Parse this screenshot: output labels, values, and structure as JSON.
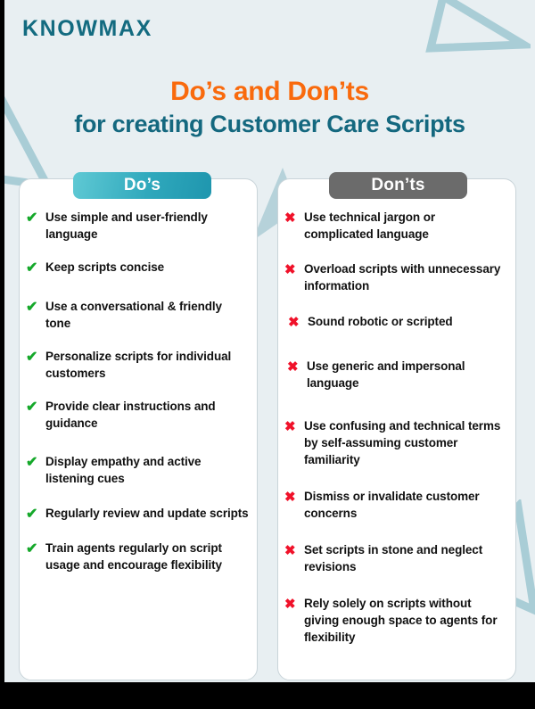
{
  "brand": {
    "logo_text": "KNOWMAX",
    "logo_color": "#136b80"
  },
  "title": {
    "line1": "Do’s and Don’ts",
    "line1_color": "#f96a0d",
    "line2": "for creating Customer Care Scripts",
    "line2_color": "#14687f"
  },
  "columns": {
    "dos": {
      "header": "Do’s",
      "header_bg": "#2fa8bc",
      "mark_icon": "check-icon",
      "mark_glyph": "✔",
      "mark_color": "#15a82a",
      "items": [
        "Use simple and user-friendly language",
        "Keep scripts concise",
        "Use a conversational & friendly tone",
        "Personalize scripts for individual customers",
        "Provide clear instructions and guidance",
        "Display empathy and active listening cues",
        "Regularly review and update scripts",
        "Train agents regularly on script usage and encourage flexibility"
      ]
    },
    "donts": {
      "header": "Don’ts",
      "header_bg": "#6b6b6b",
      "mark_icon": "cross-icon",
      "mark_glyph": "✖",
      "mark_color": "#f0122a",
      "items": [
        "Use technical jargon or complicated language",
        "Overload scripts with unnecessary information",
        "Sound robotic or scripted",
        "Use generic and impersonal language",
        "Use confusing and technical terms by self-assuming customer familiarity",
        "Dismiss or invalidate customer concerns",
        "Set scripts in stone and neglect revisions",
        "Rely solely on scripts without giving  enough space to agents for flexibility"
      ]
    }
  },
  "theme": {
    "background": "#e8eff2",
    "card_background": "#ffffff",
    "card_border": "#c9d4d9",
    "decor_color": "#a9cdd6"
  }
}
